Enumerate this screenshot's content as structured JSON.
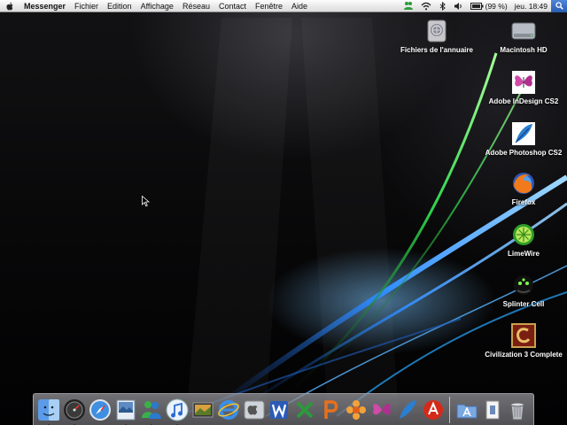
{
  "menubar": {
    "app_name": "Messenger",
    "menus": [
      "Fichier",
      "Edition",
      "Affichage",
      "Réseau",
      "Contact",
      "Fenêtre",
      "Aide"
    ],
    "battery": "(99 %)",
    "clock": "jeu. 18:49"
  },
  "desktop_icons": [
    {
      "label": "Fichiers de l'annuaire",
      "icon": "network-drive-icon"
    },
    {
      "label": "Macintosh HD",
      "icon": "hard-drive-icon"
    },
    {
      "label": "Adobe InDesign CS2",
      "icon": "indesign-butterfly-icon"
    },
    {
      "label": "Adobe Photoshop CS2",
      "icon": "photoshop-feather-icon"
    },
    {
      "label": "Firefox",
      "icon": "firefox-icon"
    },
    {
      "label": "LimeWire",
      "icon": "limewire-icon"
    },
    {
      "label": "Splinter Cell",
      "icon": "splinter-cell-icon"
    },
    {
      "label": "Civilization 3 Complete",
      "icon": "civilization-icon"
    }
  ],
  "dock": {
    "items": [
      "finder-icon",
      "dashboard-icon",
      "safari-icon",
      "preview-icon",
      "messenger-icon",
      "itunes-icon",
      "iphoto-icon",
      "ie-icon",
      "osx-icon",
      "word-icon",
      "excel-icon",
      "powerpoint-icon",
      "flower-icon",
      "indesign-dock-icon",
      "photoshop-dock-icon",
      "acrobat-icon",
      "applications-folder-icon",
      "document-icon",
      "trash-icon"
    ],
    "running": [
      "finder-icon",
      "dashboard-icon",
      "preview-icon",
      "messenger-icon",
      "itunes-icon"
    ]
  },
  "colors": {
    "menubar": "#e9e9e9",
    "desktop": "#050507",
    "swoosh_blue": "#2f8cff",
    "swoosh_green": "#2dd04a"
  }
}
